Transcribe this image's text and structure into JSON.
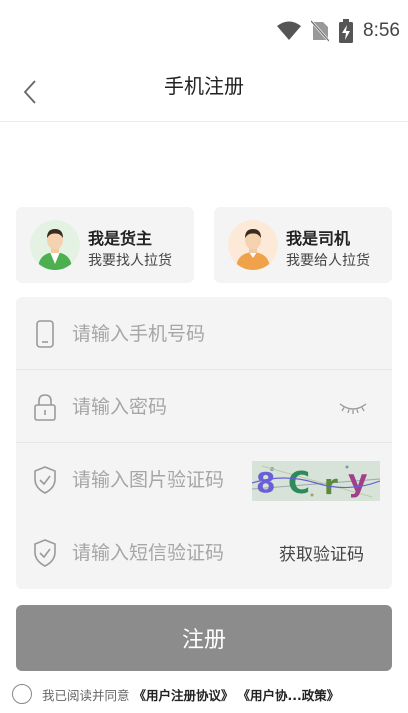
{
  "status_bar": {
    "time": "8:56",
    "icons": [
      "wifi-icon",
      "no-sim-icon",
      "battery-charging-icon"
    ]
  },
  "nav": {
    "title": "手机注册",
    "back_icon": "chevron-left-icon"
  },
  "roles": [
    {
      "title": "我是货主",
      "subtitle": "我要找人拉货",
      "accent": "#4caf50"
    },
    {
      "title": "我是司机",
      "subtitle": "我要给人拉货",
      "accent": "#f0a24a"
    }
  ],
  "form": {
    "phone_placeholder": "请输入手机号码",
    "password_placeholder": "请输入密码",
    "captcha_placeholder": "请输入图片验证码",
    "captcha_image_text": "8Cry",
    "sms_placeholder": "请输入短信验证码",
    "get_code_label": "获取验证码"
  },
  "submit": {
    "label": "注册",
    "color": "#8c8c8c"
  },
  "agreement": {
    "prefix": "我已阅读并同意",
    "link1": "《用户注册协议》",
    "link2": "《用户协...政策》"
  }
}
